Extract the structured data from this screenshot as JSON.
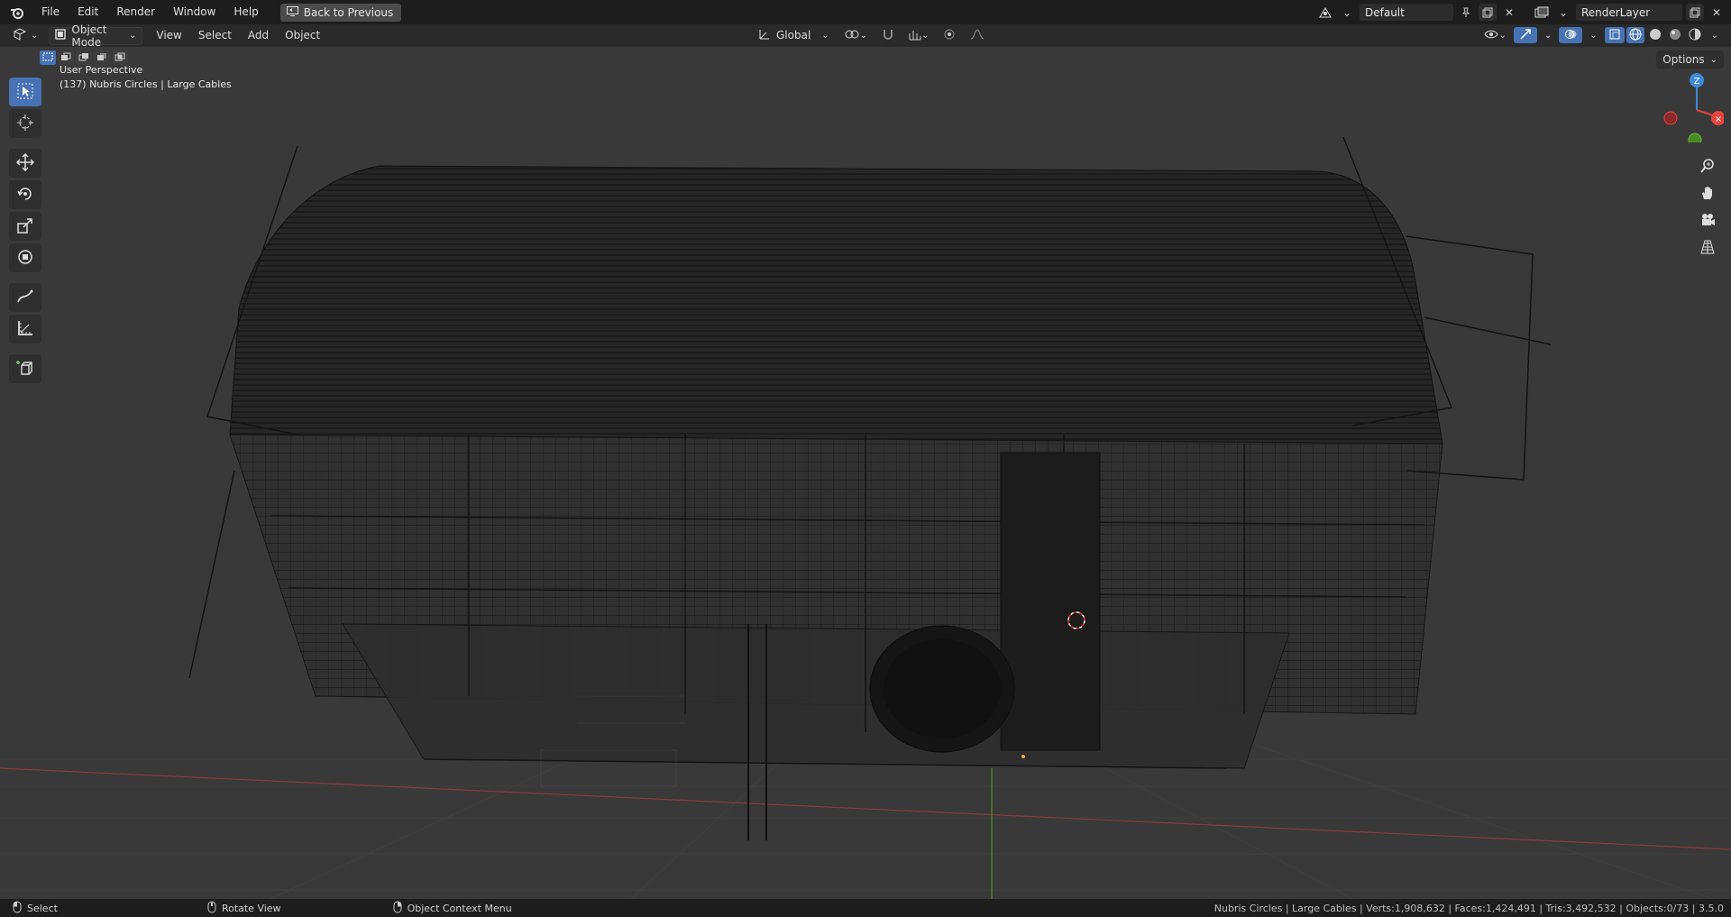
{
  "menu": {
    "file": "File",
    "edit": "Edit",
    "render": "Render",
    "window": "Window",
    "help": "Help",
    "back_to_previous": "Back to Previous"
  },
  "workspace": {
    "scene_name": "Default",
    "view_layer": "RenderLayer"
  },
  "header": {
    "mode": "Object Mode",
    "view": "View",
    "select": "Select",
    "add": "Add",
    "object": "Object",
    "orientation": "Global",
    "options": "Options"
  },
  "viewport": {
    "perspective_label": "User Perspective",
    "object_info": "(137) Nubris Circles | Large Cables"
  },
  "gizmo": {
    "z": "Z",
    "colors": {
      "x": "#e8433e",
      "y": "#6bbc33",
      "z": "#3f8ad8"
    }
  },
  "status": {
    "select": "Select",
    "rotate_view": "Rotate View",
    "context_menu": "Object Context Menu",
    "stats": "Nubris Circles | Large Cables | Verts:1,908,632 | Faces:1,424,491 | Tris:3,492,532 | Objects:0/73 | 3.5.0"
  },
  "icons": {
    "toolbar": [
      "select-box-icon",
      "cursor-icon",
      "move-icon",
      "rotate-icon",
      "scale-icon",
      "transform-icon",
      "annotate-icon",
      "measure-icon",
      "add-cube-icon"
    ],
    "nav": [
      "zoom-icon",
      "pan-hand-icon",
      "camera-icon",
      "grid-ortho-icon"
    ]
  },
  "accent": "#4772b3"
}
